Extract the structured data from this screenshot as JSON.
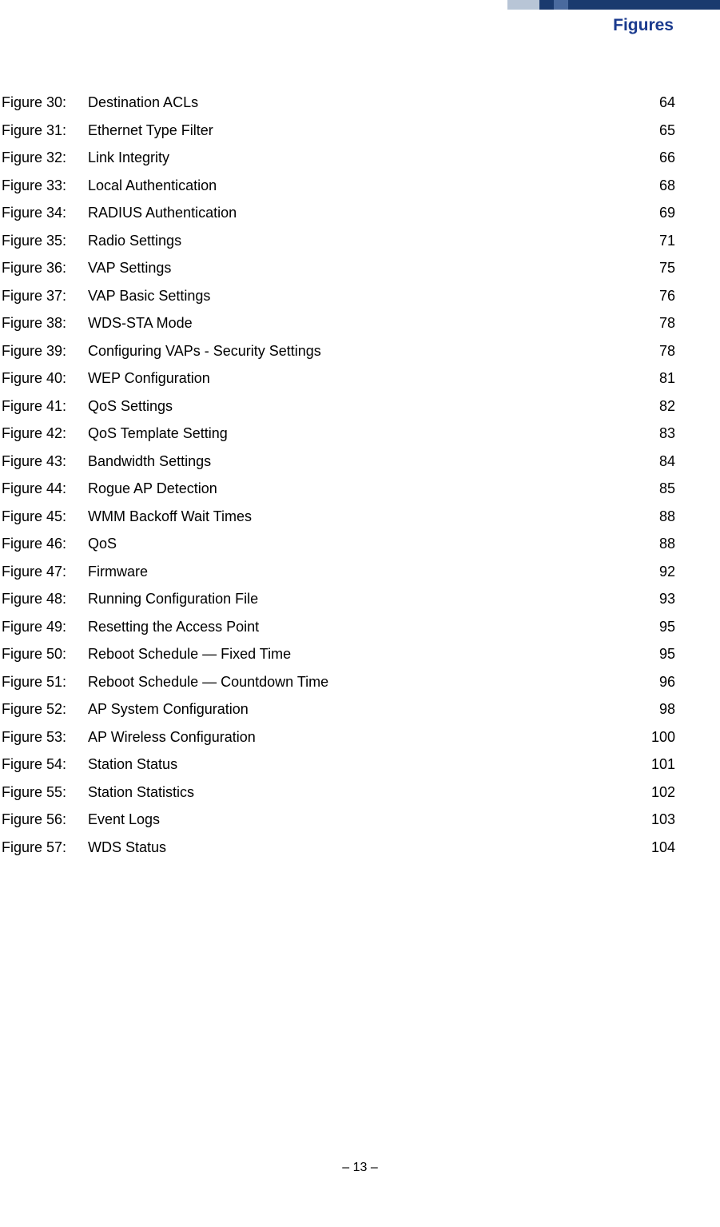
{
  "header": {
    "title": "Figures"
  },
  "figures": [
    {
      "label": "Figure 30:",
      "title": "Destination ACLs",
      "page": "64"
    },
    {
      "label": "Figure 31:",
      "title": "Ethernet Type Filter",
      "page": "65"
    },
    {
      "label": "Figure 32:",
      "title": "Link Integrity",
      "page": "66"
    },
    {
      "label": "Figure 33:",
      "title": "Local Authentication",
      "page": "68"
    },
    {
      "label": "Figure 34:",
      "title": "RADIUS Authentication",
      "page": "69"
    },
    {
      "label": "Figure 35:",
      "title": "Radio Settings",
      "page": "71"
    },
    {
      "label": "Figure 36:",
      "title": "VAP Settings",
      "page": "75"
    },
    {
      "label": "Figure 37:",
      "title": "VAP Basic Settings",
      "page": "76"
    },
    {
      "label": "Figure 38:",
      "title": "WDS-STA Mode",
      "page": "78"
    },
    {
      "label": "Figure 39:",
      "title": "Configuring VAPs - Security Settings",
      "page": "78"
    },
    {
      "label": "Figure 40:",
      "title": "WEP Configuration",
      "page": "81"
    },
    {
      "label": "Figure 41:",
      "title": "QoS Settings",
      "page": "82"
    },
    {
      "label": "Figure 42:",
      "title": "QoS Template Setting",
      "page": "83"
    },
    {
      "label": "Figure 43:",
      "title": "Bandwidth Settings",
      "page": "84"
    },
    {
      "label": "Figure 44:",
      "title": "Rogue AP Detection",
      "page": "85"
    },
    {
      "label": "Figure 45:",
      "title": "WMM Backoff Wait Times",
      "page": "88"
    },
    {
      "label": "Figure 46:",
      "title": "QoS",
      "page": "88"
    },
    {
      "label": "Figure 47:",
      "title": "Firmware",
      "page": "92"
    },
    {
      "label": "Figure 48:",
      "title": "Running Configuration File",
      "page": "93"
    },
    {
      "label": "Figure 49:",
      "title": "Resetting the Access Point",
      "page": "95"
    },
    {
      "label": "Figure 50:",
      "title": "Reboot Schedule — Fixed Time",
      "page": "95"
    },
    {
      "label": "Figure 51:",
      "title": "Reboot Schedule — Countdown Time",
      "page": "96"
    },
    {
      "label": "Figure 52:",
      "title": "AP System Configuration",
      "page": "98"
    },
    {
      "label": "Figure 53:",
      "title": "AP Wireless Configuration",
      "page": "100"
    },
    {
      "label": "Figure 54:",
      "title": "Station Status",
      "page": "101"
    },
    {
      "label": "Figure 55:",
      "title": "Station Statistics",
      "page": "102"
    },
    {
      "label": "Figure 56:",
      "title": "Event Logs",
      "page": "103"
    },
    {
      "label": "Figure 57:",
      "title": "WDS Status",
      "page": "104"
    }
  ],
  "footer": {
    "page": "–  13  –"
  }
}
